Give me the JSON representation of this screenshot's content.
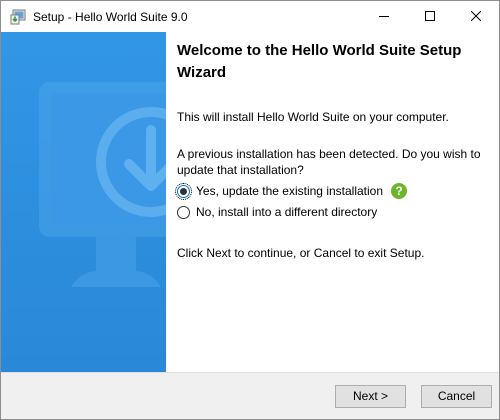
{
  "window": {
    "title": "Setup - Hello World Suite 9.0",
    "icon": "installer-icon"
  },
  "controls": {
    "minimize_icon": "minimize-icon",
    "maximize_icon": "maximize-icon",
    "close_icon": "close-icon"
  },
  "banner": {
    "icon": "monitor-download-icon",
    "color": "#2d8ee0"
  },
  "content": {
    "heading": "Welcome to the Hello World Suite Setup Wizard",
    "intro": "This will install Hello World Suite on your computer.",
    "question": "A previous installation has been detected. Do you wish to update that installation?",
    "options": [
      {
        "label": "Yes, update the existing installation",
        "selected": true
      },
      {
        "label": "No, install into a different directory",
        "selected": false
      }
    ],
    "help_icon": "help-icon",
    "help_glyph": "?",
    "instruction": "Click Next to continue, or Cancel to exit Setup."
  },
  "footer": {
    "next_label": "Next >",
    "cancel_label": "Cancel"
  },
  "colors": {
    "accent": "#0078d7",
    "help": "#6cb52d"
  }
}
